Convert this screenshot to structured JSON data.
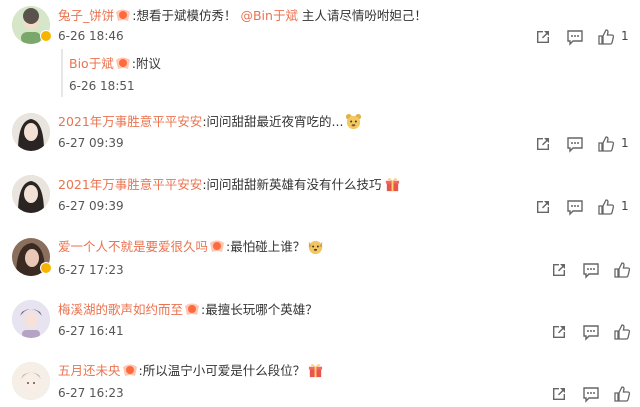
{
  "comments": [
    {
      "user": "兔子_饼饼",
      "text": ":想看于斌模仿秀！",
      "mention": "@Bin于斌",
      "text2": " 主人请尽情吩咐妲己！",
      "time": "6-26 18:46",
      "like_count": "1",
      "verified": true,
      "reply": {
        "user": "Bio于斌",
        "text": ":附议",
        "time": "6-26 18:51"
      }
    },
    {
      "user": "2021年万事胜意平平安安",
      "text": ":问问甜甜最近夜宵吃的...",
      "time": "6-27 09:39",
      "like_count": "1",
      "emoji": "bear-face-emoji"
    },
    {
      "user": "2021年万事胜意平平安安",
      "text": ":问问甜甜新英雄有没有什么技巧",
      "time": "6-27 09:39",
      "like_count": "1",
      "emoji": "gift-emoji"
    },
    {
      "user": "爱一个人不就是要爱很久吗",
      "text": ":最怕碰上谁？",
      "time": "6-27 17:23",
      "like_count": "",
      "emoji": "dog-face-emoji"
    },
    {
      "user": "梅溪湖的歌声如约而至",
      "text": ":最擅长玩哪个英雄？",
      "time": "6-27 16:41",
      "like_count": ""
    },
    {
      "user": "五月还未央",
      "text": ":所以温宁小可爱是什么段位？",
      "time": "6-27 16:23",
      "like_count": "",
      "emoji": "gift-emoji"
    }
  ],
  "icons": {
    "share": "share-icon",
    "comment": "comment-icon",
    "like": "thumbs-up-icon",
    "medal": "fan-medal-icon",
    "verified": "verified-badge-icon"
  },
  "colors": {
    "username": "#eb7350",
    "badge": "#f7b500"
  }
}
